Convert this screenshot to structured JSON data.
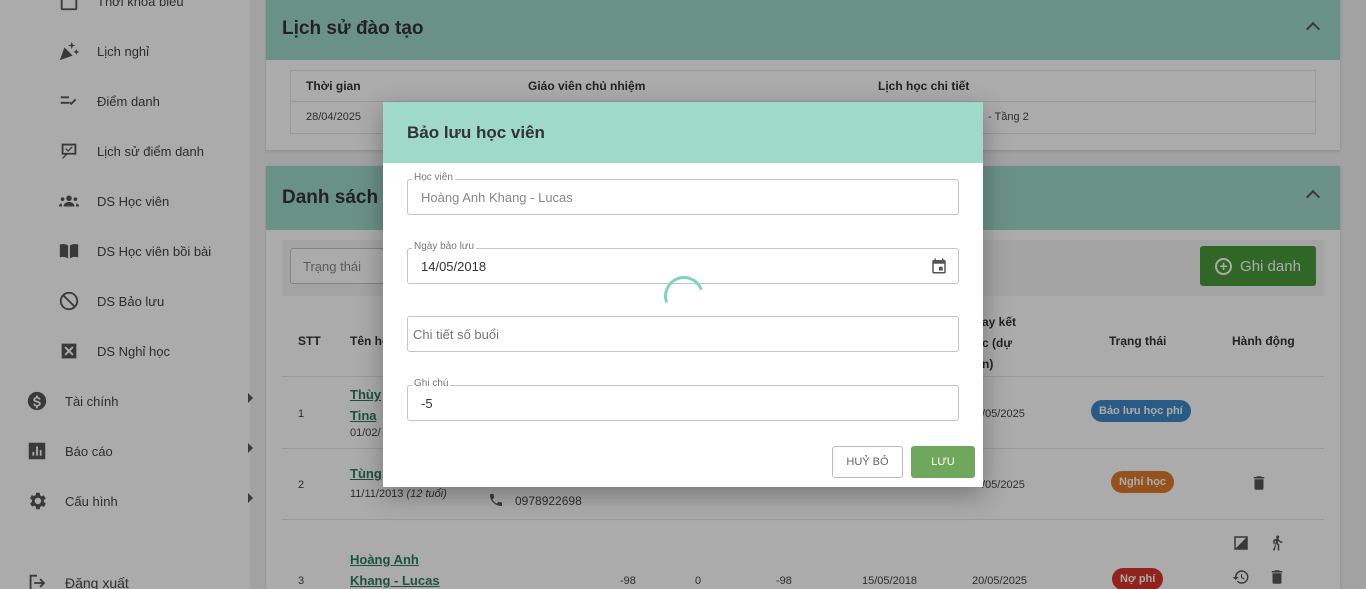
{
  "sidebar": {
    "items": [
      {
        "label": "Thời khóa biểu",
        "icon": "calendar-icon"
      },
      {
        "label": "Lịch nghỉ",
        "icon": "party-popper-icon"
      },
      {
        "label": "Điểm danh",
        "icon": "checklist-icon"
      },
      {
        "label": "Lịch sử điểm danh",
        "icon": "attendance-history-icon"
      },
      {
        "label": "DS Học viên",
        "icon": "people-icon"
      },
      {
        "label": "DS Học viên bồi bài",
        "icon": "book-icon"
      },
      {
        "label": "DS Bảo lưu",
        "icon": "block-icon"
      },
      {
        "label": "DS Nghỉ học",
        "icon": "close-box-icon"
      },
      {
        "label": "Tài chính",
        "icon": "dollar-icon"
      },
      {
        "label": "Báo cáo",
        "icon": "bar-chart-icon"
      },
      {
        "label": "Cấu hình",
        "icon": "gear-icon"
      }
    ],
    "logout": "Đăng xuất"
  },
  "history": {
    "title": "Lịch sử đào tạo",
    "headers": [
      "Thời gian",
      "Giáo viên chủ nhiệm",
      "Lịch học chi tiết"
    ],
    "row": {
      "date": "28/04/2025",
      "schedule": "- Tầng 2"
    }
  },
  "list": {
    "title": "Danh sách h",
    "filter_placeholder": "Trạng thái",
    "enroll_button": "Ghi danh",
    "headers": {
      "stt": "STT",
      "name": "Tên họ",
      "end_date": "ay kết\nc (dự\nn)",
      "status": "Trạng thái",
      "action": "Hành động"
    },
    "rows": [
      {
        "stt": "1",
        "name": "Thùy\nTina",
        "dob": "01/02/",
        "end": "/05/2025",
        "status": "Bảo lưu học phí",
        "status_color": "#3f88c5"
      },
      {
        "stt": "2",
        "name": "Tùng",
        "dob": "11/11/2013",
        "age": "(12 tuổi)",
        "phone": "0978922698",
        "end": "/05/2025",
        "status": "Nghỉ học",
        "status_color": "#e07b2a"
      },
      {
        "stt": "3",
        "name": "Hoàng Anh\nKhang - Lucas",
        "v1": "-98",
        "v2": "0",
        "v3": "-98",
        "start": "15/05/2018",
        "end": "20/05/2025",
        "status": "Nợ phí",
        "status_color": "#d9342b"
      }
    ]
  },
  "modal": {
    "title": "Bảo lưu học viên",
    "student_label": "Học viên",
    "student_value": "Hoàng Anh Khang - Lucas",
    "date_label": "Ngày bảo lưu",
    "date_value": "14/05/2018",
    "sessions_placeholder": "Chi tiết số buổi",
    "note_label": "Ghi chú",
    "note_value": "-5",
    "cancel": "HUỶ BỎ",
    "save": "LƯU"
  }
}
